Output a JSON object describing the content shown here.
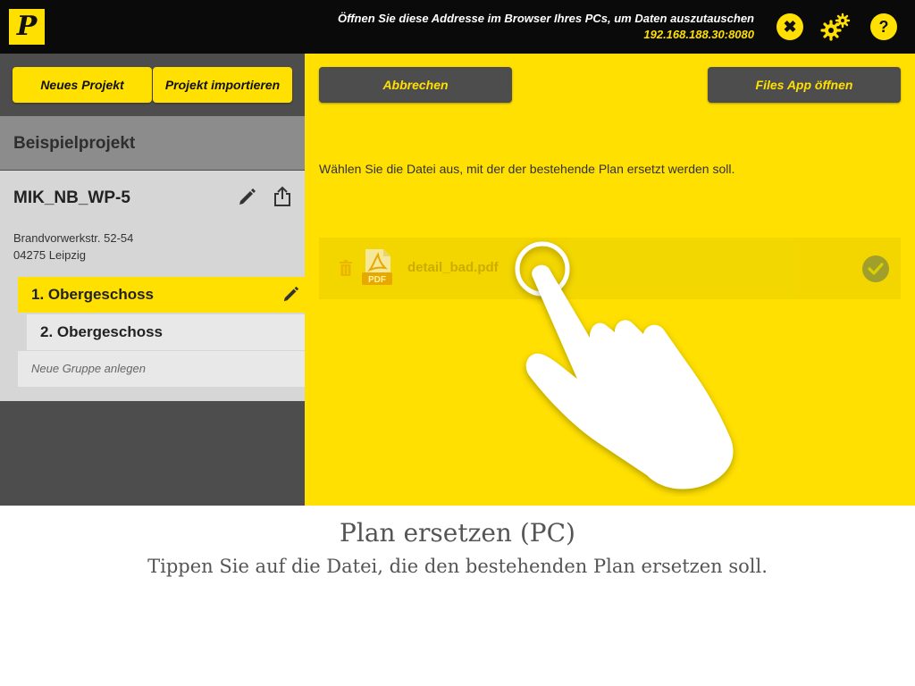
{
  "topbar": {
    "logo": "P",
    "info_line": "Öffnen Sie diese Addresse im Browser Ihres PCs, um Daten auszutauschen",
    "address": "192.168.188.30:8080",
    "close_glyph": "✖",
    "help_glyph": "?"
  },
  "left": {
    "new_project_label": "Neues Projekt",
    "import_project_label": "Projekt importieren",
    "project_name": "Beispielprojekt",
    "plan": {
      "title": "MIK_NB_WP-5",
      "address_line1": "Brandvorwerkstr. 52-54",
      "address_line2": "04275 Leipzig"
    },
    "floors": [
      {
        "label": "1. Obergeschoss",
        "active": true
      },
      {
        "label": "2. Obergeschoss",
        "active": false
      }
    ],
    "new_group_label": "Neue Gruppe anlegen"
  },
  "right": {
    "cancel_label": "Abbrechen",
    "files_app_label": "Files App öffnen",
    "instruction": "Wählen Sie die Datei aus, mit der der bestehende Plan ersetzt werden soll.",
    "file": {
      "name": "detail_bad.pdf",
      "type_label": "PDF"
    }
  },
  "caption": {
    "title": "Plan ersetzen (PC)",
    "subtitle": "Tippen Sie auf die Datei, die den bestehenden Plan ersetzen soll."
  },
  "colors": {
    "accent": "#ffe000",
    "dark": "#4d4d4d",
    "topbar": "#0a0a0a"
  },
  "icons": [
    "close-icon",
    "gear-icon",
    "help-icon",
    "edit-icon",
    "share-icon",
    "trash-icon",
    "pdf-file-icon",
    "check-icon",
    "tap-hand-icon"
  ]
}
